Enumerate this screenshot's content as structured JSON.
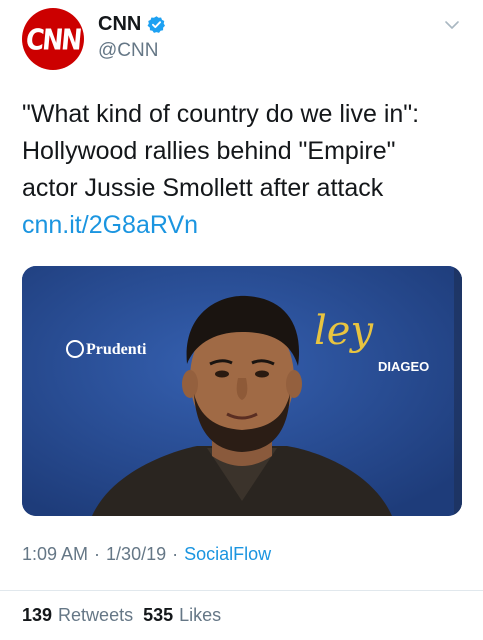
{
  "tweet": {
    "avatar_text": "CNN",
    "display_name": "CNN",
    "handle": "@CNN",
    "verified": true,
    "text_lines": [
      "\"What kind of country do we live in\":",
      "Hollywood rallies behind \"Empire\"",
      "actor Jussie Smollett after attack"
    ],
    "link": "cnn.it/2G8aRVn",
    "time": "1:09 AM",
    "date": "1/30/19",
    "source": "SocialFlow",
    "separator": "·"
  },
  "media": {
    "sponsor_left": "Prudenti",
    "sponsor_right": "DIAGEO",
    "sponsor_script": "ley"
  },
  "stats": {
    "retweets_count": "139",
    "retweets_label": "Retweets",
    "likes_count": "535",
    "likes_label": "Likes"
  },
  "colors": {
    "brand_red": "#cc0000",
    "link_blue": "#1b95e0",
    "verified_blue": "#1da1f2",
    "muted_gray": "#657786",
    "backdrop_blue": "#2a4f9a"
  },
  "icons": {
    "verified": "verified-badge-icon",
    "caret": "chevron-down-icon"
  }
}
